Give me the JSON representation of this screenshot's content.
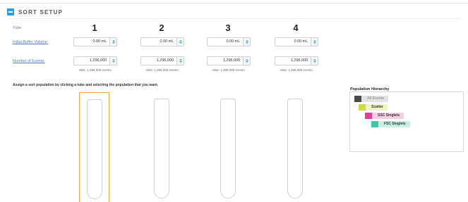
{
  "section": {
    "title": "SORT SETUP"
  },
  "rows": {
    "tube_label": "Tube",
    "buffer_label": "Initial Buffer Volume:",
    "events_label": "Number of Events:"
  },
  "tubes": [
    {
      "number": "1",
      "buffer_value": "0.00 mL",
      "events_value": "1,296,000",
      "max_note": "Max: 1,296,000 events",
      "selected": true
    },
    {
      "number": "2",
      "buffer_value": "0.00 mL",
      "events_value": "1,296,000",
      "max_note": "Max: 1,296,000 events",
      "selected": false
    },
    {
      "number": "3",
      "buffer_value": "0.00 mL",
      "events_value": "1,296,000",
      "max_note": "Max: 1,296,000 events",
      "selected": false
    },
    {
      "number": "4",
      "buffer_value": "0.00 mL",
      "events_value": "1,296,000",
      "max_note": "Max: 1,296,000 events",
      "selected": false
    }
  ],
  "instruction": "Assign a sort population by clicking a tube and selecting the population that you want.",
  "hierarchy": {
    "title": "Population Hierarchy",
    "items": [
      {
        "label": "All Events",
        "swatch": "#4a4a4a",
        "bg": "#e2e2e2",
        "text": "#9a9a9a"
      },
      {
        "label": "Scatter",
        "swatch": "#cfd94a",
        "bg": "#eef2c6",
        "text": "#333333"
      },
      {
        "label": "SSC Singlets",
        "swatch": "#e0409a",
        "bg": "#f7cde4",
        "text": "#333333"
      },
      {
        "label": "FSC Singlets",
        "swatch": "#3fc7a8",
        "bg": "#c9efe4",
        "text": "#333333"
      }
    ]
  },
  "colors": {
    "accent": "#2a9fd8",
    "selected_tube": "#f0a64a"
  }
}
